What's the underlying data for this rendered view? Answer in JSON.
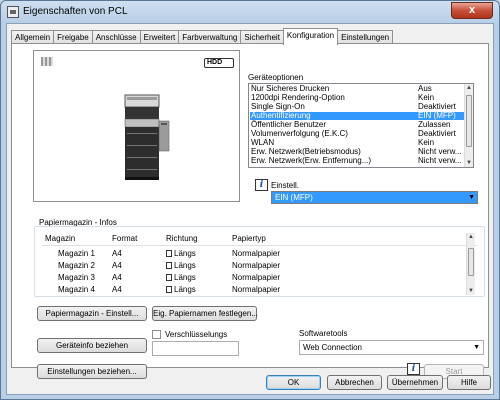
{
  "window": {
    "title": "Eigenschaften von PCL",
    "close_glyph": "x"
  },
  "tabs": [
    {
      "label": "Allgemein"
    },
    {
      "label": "Freigabe"
    },
    {
      "label": "Anschlüsse"
    },
    {
      "label": "Erweitert"
    },
    {
      "label": "Farbverwaltung"
    },
    {
      "label": "Sicherheit"
    },
    {
      "label": "Konfiguration",
      "active": true
    },
    {
      "label": "Einstellungen"
    }
  ],
  "preview": {
    "hdd_label": "HDD"
  },
  "device_options": {
    "label": "Geräteoptionen",
    "rows": [
      {
        "name": "Nur Sicheres Drucken",
        "value": "Aus"
      },
      {
        "name": "1200dpi Rendering-Option",
        "value": "Kein"
      },
      {
        "name": "Single Sign-On",
        "value": "Deaktiviert"
      },
      {
        "name": "Authentifizierung",
        "value": "EIN (MFP)",
        "selected": true
      },
      {
        "name": "Öffentlicher Benutzer",
        "value": "Zulassen"
      },
      {
        "name": "Volumenverfolgung (E.K.C)",
        "value": "Deaktiviert"
      },
      {
        "name": "WLAN",
        "value": "Kein"
      },
      {
        "name": "Erw. Netzwerk(Betriebsmodus)",
        "value": "Nicht verw..."
      },
      {
        "name": "Erw. Netzwerk(Erw. Entfernung...)",
        "value": "Nicht verw..."
      }
    ]
  },
  "setting": {
    "label": "Einstell.",
    "selected_value": "EIN (MFP)"
  },
  "paper_tray": {
    "label": "Papiermagazin - Infos",
    "columns": [
      "Magazin",
      "Format",
      "Richtung",
      "Papiertyp"
    ],
    "rows": [
      {
        "tray": "Magazin 1",
        "format": "A4",
        "direction": "Längs",
        "type": "Normalpapier"
      },
      {
        "tray": "Magazin 2",
        "format": "A4",
        "direction": "Längs",
        "type": "Normalpapier"
      },
      {
        "tray": "Magazin 3",
        "format": "A4",
        "direction": "Längs",
        "type": "Normalpapier"
      },
      {
        "tray": "Magazin 4",
        "format": "A4",
        "direction": "Längs",
        "type": "Normalpapier"
      }
    ],
    "settings_button": "Papiermagazin - Einstell...",
    "paper_names_button": "Eig. Papiernamen festlegen..."
  },
  "device_info_button": "Geräteinfo beziehen",
  "encryption": {
    "label": "Verschlüsselungs",
    "value": ""
  },
  "software_tools": {
    "label": "Softwaretools",
    "selected": "Web Connection",
    "start_button": "Start"
  },
  "get_settings_button": "Einstellungen beziehen...",
  "footer": {
    "ok": "OK",
    "cancel": "Abbrechen",
    "apply": "Übernehmen",
    "help": "Hilfe"
  }
}
